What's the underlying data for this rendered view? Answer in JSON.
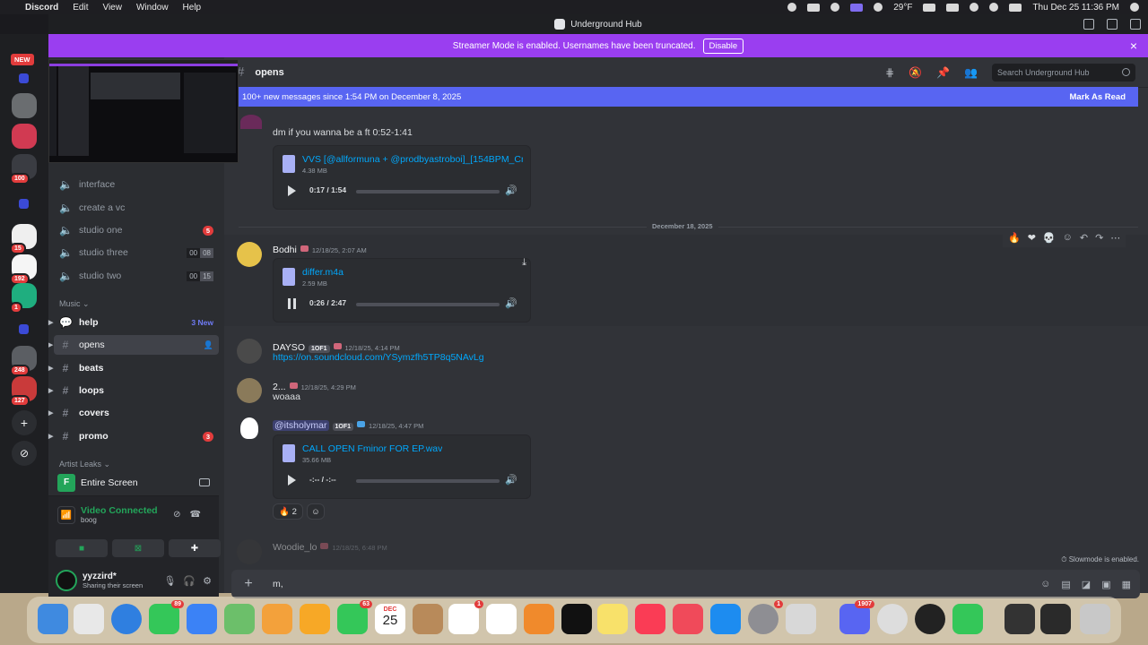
{
  "menubar": {
    "app": "Discord",
    "items": [
      "Edit",
      "View",
      "Window",
      "Help"
    ],
    "weather": "29°F",
    "clock": "Thu Dec 25  11:36 PM"
  },
  "window": {
    "title": "Underground Hub"
  },
  "banner": {
    "text": "Streamer Mode is enabled. Usernames have been truncated.",
    "button": "Disable"
  },
  "rail": {
    "new_tag": "NEW",
    "badges": [
      "100",
      "15",
      "192",
      "1",
      "248",
      "127"
    ]
  },
  "sidebar": {
    "channels_top": [
      {
        "name": "interface"
      },
      {
        "name": "create a vc"
      },
      {
        "name": "studio one",
        "badge": "5"
      },
      {
        "name": "studio three",
        "count_a": "00",
        "count_b": "08"
      },
      {
        "name": "studio two",
        "count_a": "00",
        "count_b": "15"
      }
    ],
    "category_music": "Music",
    "music_channels": [
      {
        "name": "help",
        "new_label": "3 New"
      },
      {
        "name": "opens"
      },
      {
        "name": "beats"
      },
      {
        "name": "loops"
      },
      {
        "name": "covers"
      },
      {
        "name": "promo",
        "badge": "3"
      }
    ],
    "category_artist_leaks": "Artist Leaks"
  },
  "voice": {
    "screen_label": "Entire Screen",
    "status": "Video Connected",
    "channel": "boog"
  },
  "user": {
    "name": "yyzzird*",
    "status": "Sharing their screen"
  },
  "channel_header": {
    "name": "opens",
    "search_placeholder": "Search Underground Hub"
  },
  "new_messages": {
    "text": "100+ new messages since 1:54 PM on December 8, 2025",
    "action": "Mark As Read"
  },
  "messages": {
    "first_text": "dm if you wanna be a ft   0:52-1:41",
    "attachment1": {
      "name": "VVS [@allformuna + @prodbyastroboi]_[154BPM_Cma",
      "size": "4.38 MB",
      "time": "0:17 / 1:54",
      "progress": 0.73
    },
    "date_divider": "December 18, 2025",
    "bodhi": {
      "name": "Bodhi",
      "time": "12/18/25, 2:07 AM"
    },
    "attachment2": {
      "name": "differ.m4a",
      "size": "2.59 MB",
      "time": "0:26 / 2:47",
      "progress": 1.0
    },
    "dayso": {
      "name": "DAYSO",
      "tag": "1OF1",
      "time": "12/18/25, 4:14 PM",
      "link": "https://on.soundcloud.com/YSymzfh5TP8q5NAvLg"
    },
    "short": {
      "name": "2...",
      "time": "12/18/25, 4:29 PM",
      "text": "woaaa"
    },
    "holy": {
      "name": "@itsholymar",
      "tag": "1OF1",
      "time": "12/18/25, 4:47 PM"
    },
    "attachment3": {
      "name": "CALL OPEN Fminor FOR EP.wav",
      "size": "35.66 MB",
      "time": "-:-- / -:--",
      "progress": 0.0
    },
    "reaction_count": "2",
    "woodie": {
      "name": "Woodie_lo",
      "time": "12/18/25, 6:48 PM"
    }
  },
  "slowmode": "Slowmode is enabled.",
  "composer": {
    "value": "m,"
  },
  "dock": {
    "messages_badge": "89",
    "facetime_badge": "63",
    "calendar_month": "DEC",
    "calendar_day": "25",
    "reminders_badge": "1",
    "settings_badge": "1",
    "discord_badge": "1907"
  }
}
